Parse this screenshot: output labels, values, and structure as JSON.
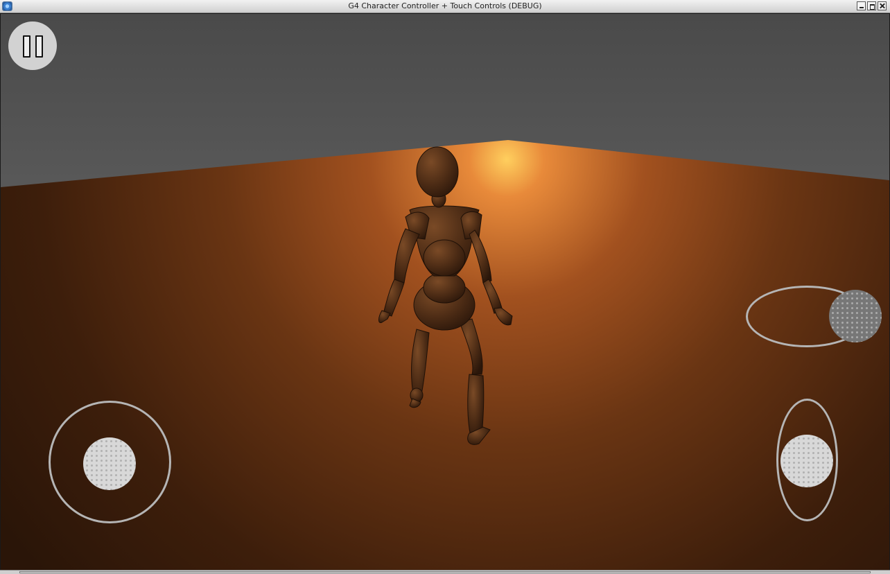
{
  "window": {
    "title": "G4 Character Controller + Touch Controls (DEBUG)"
  },
  "scene": {
    "sky_color": "#555555",
    "floor_color": "#7a3a12",
    "light_color": "#ffb44a",
    "character_color": "#4a2a14"
  },
  "hud": {
    "pause_button": "pause-icon",
    "left_stick": {
      "axis": "2d",
      "value_x": 0,
      "value_y": 0
    },
    "right_horizontal_slider": {
      "axis": "horizontal",
      "value": 1.0
    },
    "right_vertical_slider": {
      "axis": "vertical",
      "value": 0
    }
  }
}
